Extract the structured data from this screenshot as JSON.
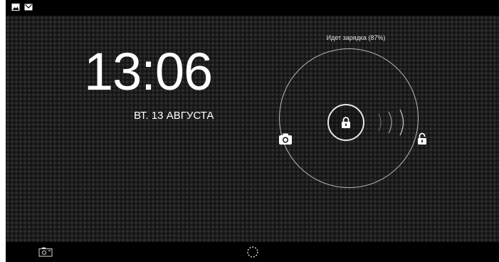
{
  "status_bar": {
    "icons": [
      "picture-icon",
      "gmail-icon"
    ]
  },
  "lockscreen": {
    "time": "13:06",
    "date": "ВТ. 13 АВГУСТА",
    "charging_status": "Идет зарядка (87%)",
    "targets": [
      "camera-icon",
      "lock-icon",
      "unlock-icon"
    ]
  },
  "nav_bar": {
    "icons": [
      "screenshot-camera-icon",
      "spinner-icon"
    ]
  },
  "colors": {
    "text": "#ffffff",
    "ring": "#bdbdbd",
    "background": "#1c1c1c"
  }
}
